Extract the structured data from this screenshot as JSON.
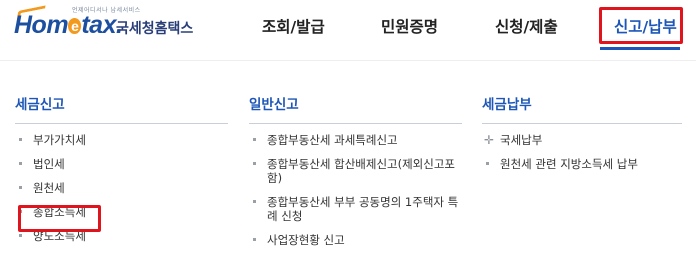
{
  "header": {
    "logo": {
      "tagline": "언제어디서나 납세서비스",
      "wordmark_left": "Hom",
      "wordmark_e": "e",
      "wordmark_right": "tax.",
      "korean_name": "국세청홈택스"
    },
    "nav": [
      {
        "label": "조회/발급"
      },
      {
        "label": "민원증명"
      },
      {
        "label": "신청/제출"
      },
      {
        "label": "신고/납부",
        "active": true
      }
    ],
    "colors": {
      "brand_blue": "#1d56b8",
      "highlight_red": "#e0141d",
      "logo_orange": "#f39a1e"
    }
  },
  "menu": {
    "col1": {
      "title": "세금신고",
      "items": [
        "부가가치세",
        "법인세",
        "원천세",
        "종합소득세",
        "양도소득세"
      ]
    },
    "col2": {
      "title": "일반신고",
      "items": [
        "종합부동산세 과세특례신고",
        "종합부동산세 합산배제신고(제외신고포함)",
        "종합부동산세 부부 공동명의 1주택자 특례 신청",
        "사업장현황 신고"
      ]
    },
    "col3": {
      "title": "세금납부",
      "items": [
        "국세납부",
        "원천세 관련 지방소득세 납부"
      ]
    }
  }
}
